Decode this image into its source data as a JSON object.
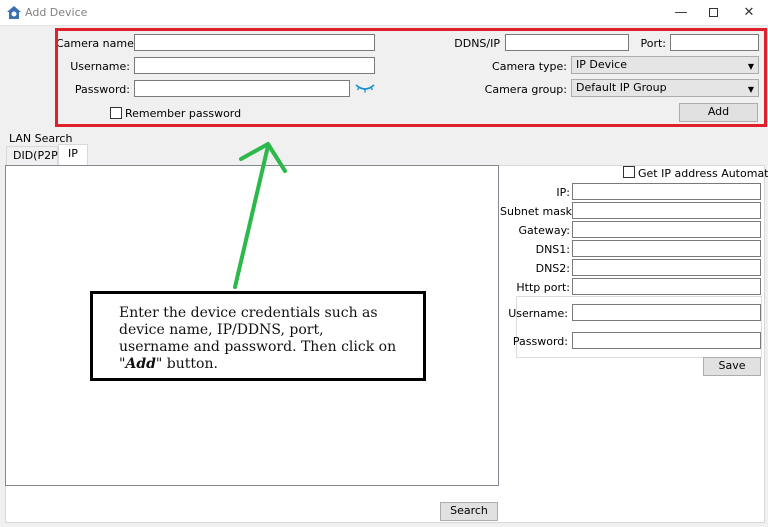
{
  "window": {
    "title": "Add Device",
    "minimize": "—",
    "close": "✕"
  },
  "form": {
    "camera_name_label": "Camera name:",
    "camera_name_value": "",
    "username_label": "Username:",
    "username_value": "",
    "password_label": "Password:",
    "password_value": "",
    "remember_password_label": "Remember password",
    "remember_password_checked": false,
    "ddns_label": "DDNS/IP",
    "ddns_value": "",
    "port_label": "Port:",
    "port_value": "",
    "camera_type_label": "Camera type:",
    "camera_type_value": "IP Device",
    "camera_group_label": "Camera group:",
    "camera_group_value": "Default IP Group",
    "add_button": "Add"
  },
  "lan_search": {
    "label": "LAN Search",
    "tabs": [
      {
        "label": "DID(P2P)",
        "active": false
      },
      {
        "label": "IP",
        "active": true
      }
    ],
    "search_button": "Search"
  },
  "ip_config": {
    "auto_ip_label": "Get IP address Automatically",
    "auto_ip_checked": false,
    "ip_label": "IP:",
    "subnet_label": "Subnet mask:",
    "gateway_label": "Gateway:",
    "dns1_label": "DNS1:",
    "dns2_label": "DNS2:",
    "http_port_label": "Http port:",
    "username_label": "Username:",
    "password_label": "Password:",
    "save_button": "Save"
  },
  "callout": {
    "text_before": "Enter the device credentials such as device name, IP/DDNS, port, username and password. Then click on \"",
    "emphasis": "Add",
    "text_after": "\" button."
  },
  "colors": {
    "highlight_border": "#e0202c",
    "arrow": "#2db84a",
    "eye_icon": "#1a8fd6"
  }
}
